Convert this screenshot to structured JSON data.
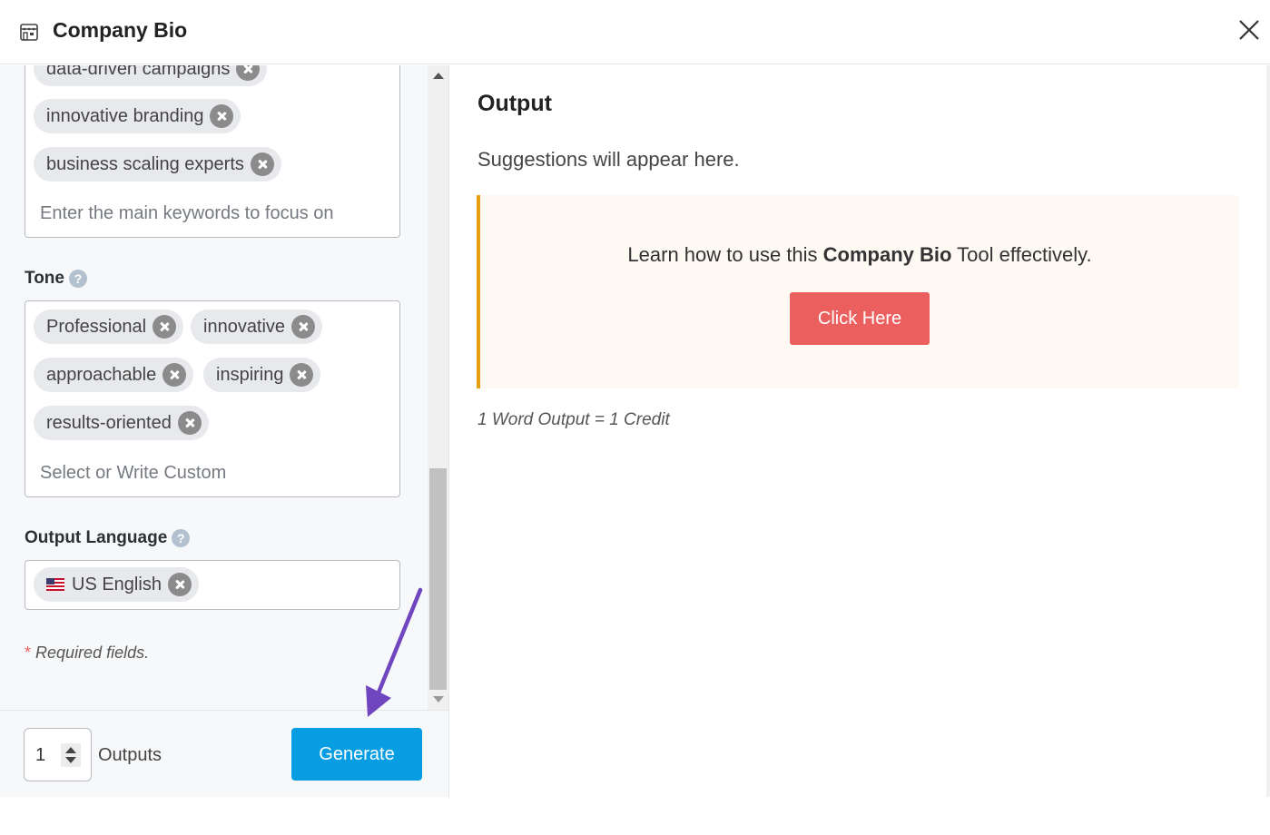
{
  "header": {
    "icon": "store-icon",
    "title": "Company Bio",
    "close_icon": "close-icon"
  },
  "form": {
    "keywords": {
      "tags": [
        "data-driven campaigns",
        "innovative branding",
        "business scaling experts"
      ],
      "placeholder": "Enter the main keywords to focus on"
    },
    "tone": {
      "label": "Tone",
      "help": "?",
      "tags": [
        "Professional",
        "innovative",
        "approachable",
        "inspiring",
        "results-oriented"
      ],
      "placeholder": "Select or Write Custom"
    },
    "output_language": {
      "label": "Output Language",
      "help": "?",
      "selected": "US English",
      "flag_icon": "us-flag-icon"
    },
    "required_note": {
      "star": "*",
      "text": "Required fields."
    }
  },
  "footer": {
    "outputs_value": "1",
    "outputs_label": "Outputs",
    "generate_label": "Generate"
  },
  "output": {
    "title": "Output",
    "subtitle": "Suggestions will appear here.",
    "callout": {
      "text_before": "Learn how to use this ",
      "text_bold": "Company Bio",
      "text_after": " Tool effectively.",
      "button_label": "Click Here"
    },
    "credit_note": "1 Word Output = 1 Credit"
  },
  "colors": {
    "generate": "#069de3",
    "click_here": "#eb5f5f",
    "callout_border": "#e6a010",
    "callout_bg": "#fef9f3",
    "annotation_arrow": "#7046c0"
  }
}
